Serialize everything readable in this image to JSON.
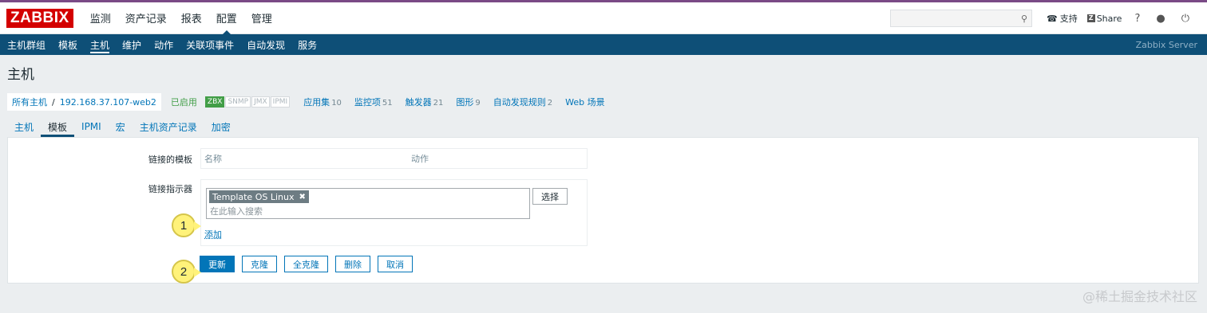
{
  "logo": "ZABBIX",
  "main_nav": [
    {
      "label": "监测",
      "active": false
    },
    {
      "label": "资产记录",
      "active": false
    },
    {
      "label": "报表",
      "active": false
    },
    {
      "label": "配置",
      "active": true
    },
    {
      "label": "管理",
      "active": false
    }
  ],
  "header": {
    "search_placeholder": "",
    "support_label": "支持",
    "share_label": "Share",
    "help_icon": "?",
    "user_icon": "user-icon",
    "logout_icon": "power-icon"
  },
  "sub_nav": [
    {
      "label": "主机群组",
      "active": false
    },
    {
      "label": "模板",
      "active": false
    },
    {
      "label": "主机",
      "active": true
    },
    {
      "label": "维护",
      "active": false
    },
    {
      "label": "动作",
      "active": false
    },
    {
      "label": "关联项事件",
      "active": false
    },
    {
      "label": "自动发现",
      "active": false
    },
    {
      "label": "服务",
      "active": false
    }
  ],
  "server_label": "Zabbix Server",
  "page_title": "主机",
  "breadcrumb": {
    "all_hosts": "所有主机",
    "separator": "/",
    "host": "192.168.37.107-web2",
    "status": "已启用",
    "badges": [
      {
        "label": "ZBX",
        "on": true
      },
      {
        "label": "SNMP",
        "on": false
      },
      {
        "label": "JMX",
        "on": false
      },
      {
        "label": "IPMI",
        "on": false
      }
    ],
    "links": [
      {
        "label": "应用集",
        "count": "10"
      },
      {
        "label": "监控项",
        "count": "51"
      },
      {
        "label": "触发器",
        "count": "21"
      },
      {
        "label": "图形",
        "count": "9"
      },
      {
        "label": "自动发现规则",
        "count": "2"
      },
      {
        "label": "Web 场景",
        "count": ""
      }
    ]
  },
  "tabs": [
    {
      "label": "主机",
      "active": false
    },
    {
      "label": "模板",
      "active": true
    },
    {
      "label": "IPMI",
      "active": false
    },
    {
      "label": "宏",
      "active": false
    },
    {
      "label": "主机资产记录",
      "active": false
    },
    {
      "label": "加密",
      "active": false
    }
  ],
  "form": {
    "linked_templates_label": "链接的模板",
    "linked_table_headers": [
      "名称",
      "动作"
    ],
    "link_indicator_label": "链接指示器",
    "selected_template": "Template OS Linux",
    "search_placeholder": "在此输入搜索",
    "select_button": "选择",
    "add_link": "添加"
  },
  "buttons": {
    "update": "更新",
    "clone": "克隆",
    "full_clone": "全克隆",
    "delete": "删除",
    "cancel": "取消"
  },
  "callouts": [
    "1",
    "2"
  ],
  "watermark": "@稀土掘金技术社区",
  "colors": {
    "brand_red": "#d40000",
    "nav_blue": "#0e4f77",
    "link_blue": "#0275b8",
    "enabled_green": "#429e47",
    "callout_yellow": "#fff27a"
  }
}
